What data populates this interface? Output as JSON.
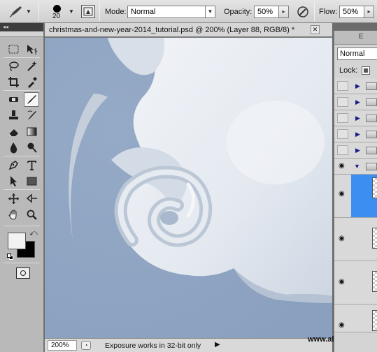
{
  "options_bar": {
    "brush_size": "20",
    "mode_label": "Mode:",
    "mode_value": "Normal",
    "opacity_label": "Opacity:",
    "opacity_value": "50%",
    "flow_label": "Flow:",
    "flow_value": "50%"
  },
  "toolbox": {
    "collapse_glyph": "◂◂",
    "active_tool": "brush-tool",
    "tools": [
      "marquee-tool",
      "move-tool",
      "lasso-tool",
      "magic-wand-tool",
      "crop-tool",
      "eyedropper-tool",
      "spot-healing-tool",
      "brush-tool",
      "clone-stamp-tool",
      "history-brush-tool",
      "eraser-tool",
      "gradient-tool",
      "blur-tool",
      "dodge-tool",
      "pen-tool",
      "type-tool",
      "path-selection-tool",
      "rectangle-tool",
      "hand-rotate-tool",
      "zoom-tool"
    ],
    "foreground_color": "#f2f2f2",
    "background_color": "#000000"
  },
  "document": {
    "title": "christmas-and-new-year-2014_tutorial.psd @ 200% (Layer 88, RGB/8) *",
    "close_glyph": "✕",
    "canvas_colors": {
      "sky": "#8ea4c2",
      "cloud": "#e9edf3",
      "swirl_shadow": "#b8c4d4"
    }
  },
  "status_bar": {
    "zoom": "200%",
    "message": "Exposure works in 32-bit only",
    "arrow_glyph": "▶"
  },
  "watermark": "www.alfoart.com",
  "layers_panel": {
    "tab_label": "E",
    "blend_mode": "Normal",
    "lock_label": "Lock:",
    "rows": [
      {
        "type": "group",
        "eye": false
      },
      {
        "type": "group",
        "eye": false
      },
      {
        "type": "group",
        "eye": false
      },
      {
        "type": "group",
        "eye": false
      },
      {
        "type": "group",
        "eye": false
      },
      {
        "type": "group-open",
        "eye": true
      },
      {
        "type": "layer",
        "eye": true,
        "selected": true
      },
      {
        "type": "layer",
        "eye": true
      },
      {
        "type": "layer",
        "eye": true
      },
      {
        "type": "layer",
        "eye": true
      }
    ],
    "selected_color": "#3c8ff0"
  }
}
